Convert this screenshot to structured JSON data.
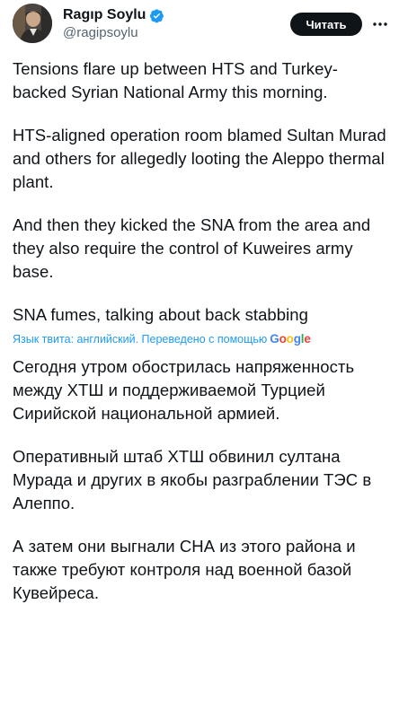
{
  "author": {
    "name": "Ragıp Soylu",
    "handle": "@ragipsoylu"
  },
  "header": {
    "read_button_label": "Читать"
  },
  "tweet": {
    "paragraphs": [
      "Tensions flare up between HTS and Turkey-backed Syrian National Army this morning.",
      "HTS-aligned operation room blamed Sultan Murad and others for allegedly looting the Aleppo thermal plant.",
      "And then they kicked the SNA from the area and they also require the control of Kuweires army base.",
      "SNA fumes, talking about back stabbing"
    ]
  },
  "translation": {
    "notice": "Язык твита: английский. Переведено с помощью",
    "provider": "Google",
    "paragraphs": [
      "Сегодня утром обострилась напряженность между ХТШ и поддерживаемой Турцией Сирийской национальной армией.",
      "Оперативный штаб ХТШ обвинил султана Мурада и других в якобы разграблении ТЭС в Алеппо.",
      "А затем они выгнали СНА из этого района и также требуют контроля над военной базой Кувейреса."
    ]
  },
  "colors": {
    "verified": "#1d9bf0",
    "link": "#1d9bf0",
    "text": "#0f1419",
    "muted": "#536471"
  },
  "icons": [
    "verified-badge-icon",
    "more-options-icon"
  ]
}
